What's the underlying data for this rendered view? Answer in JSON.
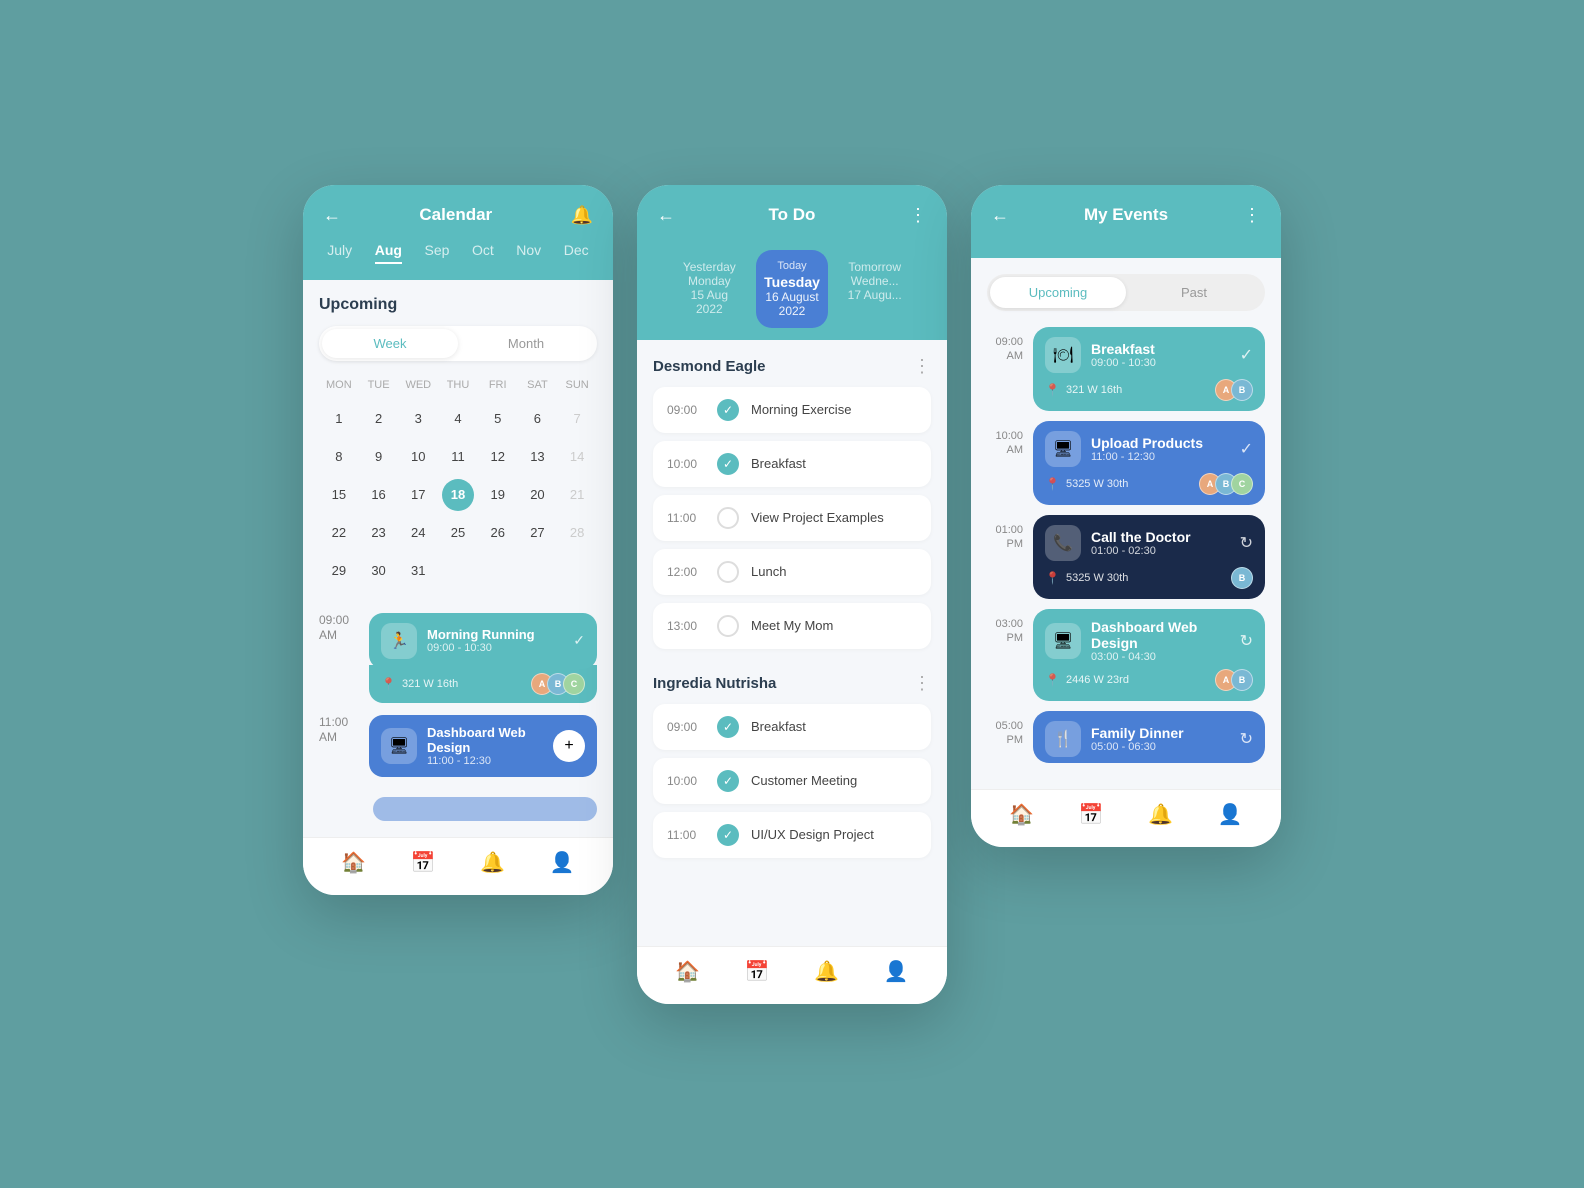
{
  "calendar": {
    "title": "Calendar",
    "months": [
      "July",
      "Aug",
      "Sep",
      "Oct",
      "Nov",
      "Dec"
    ],
    "activeMonth": "Aug",
    "weekToggle": [
      "Week",
      "Month"
    ],
    "activeToggle": "Week",
    "dayLabels": [
      "MON",
      "TUE",
      "WED",
      "THU",
      "FRI",
      "SAT",
      "SUN"
    ],
    "weeks": [
      [
        {
          "d": "1"
        },
        {
          "d": "2"
        },
        {
          "d": "3"
        },
        {
          "d": "4"
        },
        {
          "d": "5"
        },
        {
          "d": "6"
        },
        {
          "d": "7",
          "m": true
        }
      ],
      [
        {
          "d": "8"
        },
        {
          "d": "9"
        },
        {
          "d": "10"
        },
        {
          "d": "11"
        },
        {
          "d": "12"
        },
        {
          "d": "13"
        },
        {
          "d": "14",
          "m": true
        }
      ],
      [
        {
          "d": "15"
        },
        {
          "d": "16"
        },
        {
          "d": "17"
        },
        {
          "d": "18",
          "t": true
        },
        {
          "d": "19"
        },
        {
          "d": "20"
        },
        {
          "d": "21",
          "m": true
        }
      ],
      [
        {
          "d": "22"
        },
        {
          "d": "23"
        },
        {
          "d": "24"
        },
        {
          "d": "25"
        },
        {
          "d": "26"
        },
        {
          "d": "27"
        },
        {
          "d": "28",
          "m": true
        }
      ],
      [
        {
          "d": "29"
        },
        {
          "d": "30"
        },
        {
          "d": "31"
        }
      ]
    ],
    "upcomingLabel": "Upcoming",
    "events": [
      {
        "timeLabel": "09:00\nAM",
        "title": "Morning Running",
        "timeRange": "09:00 - 10:30",
        "icon": "🏃",
        "color": "teal",
        "location": "321 W 16th",
        "avatars": [
          "a1",
          "a2",
          "a3"
        ]
      },
      {
        "timeLabel": "11:00\nAM",
        "title": "Dashboard Web Design",
        "timeRange": "11:00 - 12:30",
        "icon": "🖥",
        "color": "blue",
        "location": ""
      }
    ],
    "nav": [
      "🏠",
      "📅",
      "🔔",
      "👤"
    ]
  },
  "todo": {
    "title": "To Do",
    "dates": [
      {
        "label": "Yesterday",
        "sub1": "Monday",
        "sub2": "15 Aug 2022",
        "active": false
      },
      {
        "label": "Today",
        "sub1": "Tuesday",
        "sub2": "16 August 2022",
        "active": true
      },
      {
        "label": "Tomorrow",
        "sub1": "Wedne...",
        "sub2": "17 Augu...",
        "active": false
      }
    ],
    "persons": [
      {
        "name": "Desmond Eagle",
        "tasks": [
          {
            "time": "09:00",
            "label": "Morning Exercise",
            "done": true
          },
          {
            "time": "10:00",
            "label": "Breakfast",
            "done": true
          },
          {
            "time": "11:00",
            "label": "View Project Examples",
            "done": false
          },
          {
            "time": "12:00",
            "label": "Lunch",
            "done": false
          },
          {
            "time": "13:00",
            "label": "Meet My Mom",
            "done": false
          }
        ]
      },
      {
        "name": "Ingredia Nutrisha",
        "tasks": [
          {
            "time": "09:00",
            "label": "Breakfast",
            "done": true
          },
          {
            "time": "10:00",
            "label": "Customer Meeting",
            "done": true
          },
          {
            "time": "11:00",
            "label": "UI/UX Design Project",
            "done": true
          }
        ]
      }
    ],
    "nav": [
      "🏠",
      "📅",
      "🔔",
      "👤"
    ]
  },
  "myevents": {
    "title": "My Events",
    "tabs": [
      "Upcoming",
      "Past"
    ],
    "activeTab": "Upcoming",
    "events": [
      {
        "timeLabel": "09:00\nAM",
        "title": "Breakfast",
        "timeRange": "09:00 - 10:30",
        "icon": "🍽",
        "color": "card-teal",
        "location": "321 W 16th",
        "avatars": [
          "a1",
          "a2"
        ],
        "actionIcon": "✓"
      },
      {
        "timeLabel": "10:00\nAM",
        "title": "Upload Products",
        "timeRange": "11:00 - 12:30",
        "icon": "🖥",
        "color": "card-blue",
        "location": "5325 W 30th",
        "avatars": [
          "a1",
          "a2",
          "a3"
        ],
        "actionIcon": "✓"
      },
      {
        "timeLabel": "01:00\nPM",
        "title": "Call the Doctor",
        "timeRange": "01:00 - 02:30",
        "icon": "📞",
        "color": "card-dark",
        "location": "5325 W 30th",
        "avatars": [
          "a2"
        ],
        "actionIcon": "↻"
      },
      {
        "timeLabel": "03:00\nPM",
        "title": "Dashboard Web Design",
        "timeRange": "03:00 - 04:30",
        "icon": "🖥",
        "color": "card-teal",
        "location": "2446 W 23rd",
        "avatars": [
          "a1",
          "a2"
        ],
        "actionIcon": "↻"
      },
      {
        "timeLabel": "05:00\nPM",
        "title": "Family Dinner",
        "timeRange": "05:00 - 06:30",
        "icon": "🍴",
        "color": "card-blue",
        "location": "",
        "avatars": [],
        "actionIcon": "↻"
      }
    ],
    "nav": [
      "🏠",
      "📅",
      "🔔",
      "👤"
    ]
  }
}
